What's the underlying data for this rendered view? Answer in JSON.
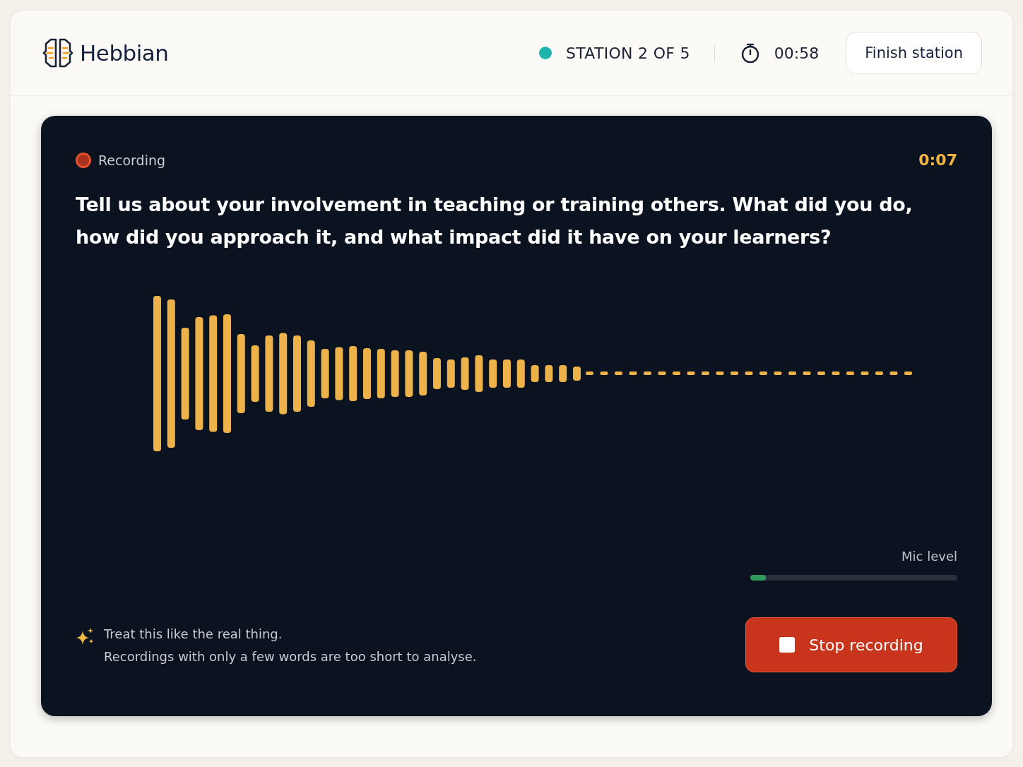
{
  "header": {
    "brand": "Hebbian",
    "station": {
      "label": "STATION 2 OF 5",
      "color": "#1fb5ad"
    },
    "timer": "00:58",
    "finish_button": "Finish station"
  },
  "panel": {
    "status": "Recording",
    "elapsed": "0:07",
    "question": "Tell us about your involvement in teaching or training others. What did you do, how did you approach it, and what impact did it have on your learners?",
    "mic": {
      "label": "Mic level",
      "level": 0.075
    },
    "tips": [
      "Treat this like the real thing.",
      "Recordings with only a few words are too short to analyse."
    ],
    "stop_button": "Stop recording"
  }
}
